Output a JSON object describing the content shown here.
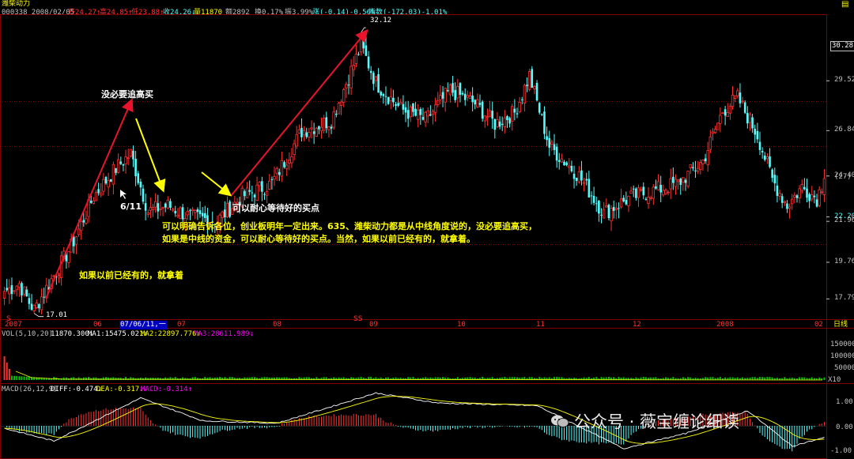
{
  "header": {
    "stock_name": "潍柴动力",
    "line2_code_date": "000338 2008/02/05",
    "open": "开24.27↑",
    "high": "高24.85↑",
    "low": "低23.88↑",
    "close": "收24.26↓",
    "volume": "量11870",
    "amount": "额2892",
    "turnover": "换0.17%",
    "amplitude": "振3.99%",
    "change": "涨(-0.14)-0.56%",
    "index": "指数(-172.03)-1.01%"
  },
  "colors": {
    "up": "#ff3232",
    "down": "#54fcfc",
    "ma1": "#ffffff",
    "ma2": "#ffff00",
    "ma3": "#ff00ff",
    "grid": "#800000",
    "arrow_red": "#e8142d",
    "arrow_yellow": "#ffff00"
  },
  "price_axis": {
    "ticks": [
      "30.28",
      "29.52",
      "26.84",
      "24.40",
      "22.20",
      "21.96",
      "19.76",
      "17.79"
    ],
    "current_badge": "(27)"
  },
  "date_axis": {
    "labels": [
      "2007",
      "06",
      "07/06/11,一",
      "07",
      "08",
      "09",
      "10",
      "11",
      "12",
      "2008",
      "02"
    ],
    "marker_s": "S",
    "marker_ss": "SS",
    "period": "日线"
  },
  "annotations": {
    "high_label": "32.12",
    "low_label": "17.01",
    "no_chase": "没必要追高买",
    "date_611": "6/11",
    "wait_buy": "可以耐心等待好的买点",
    "para1": "可以明确告诉各位，创业板明年一定出来。635、潍柴动力都是从中线角度说的，没必要追高买，",
    "para2": "如果是中线的资金，可以耐心等待好的买点。当然，如果以前已经有的，就拿着。",
    "hold": "如果以前已经有的，就拿着"
  },
  "volume_panel": {
    "title": "VOL(5,10,20)",
    "value": "11870.300↓",
    "ma1": "MA1:15475.021↓",
    "ma2": "MA2:22897.776↓",
    "ma3": "MA3:28611.989↓",
    "ticks": [
      "150000",
      "100000",
      "50000",
      "X10"
    ]
  },
  "macd_panel": {
    "title": "MACD(26,12,9)",
    "diff": "DIFF:-0.474↓",
    "dea": "DEA:-0.317↓",
    "macd": "MACD:-0.314↑",
    "ticks": [
      "1.00",
      "0.00",
      "-1.00"
    ]
  },
  "watermark": "公众号 · 薇宝缠论细读",
  "chart_data": {
    "type": "candlestick",
    "title": "潍柴动力",
    "ylim": [
      16.7,
      33.1
    ],
    "anchors": [
      {
        "i": 0,
        "close": 18.2
      },
      {
        "i": 6,
        "close": 18.6
      },
      {
        "i": 10,
        "close": 17.6
      },
      {
        "i": 12,
        "close": 17.2
      },
      {
        "i": 18,
        "close": 18.6
      },
      {
        "i": 27,
        "close": 20.6
      },
      {
        "i": 36,
        "close": 23.3
      },
      {
        "i": 45,
        "close": 24.8
      },
      {
        "i": 51,
        "close": 25.6
      },
      {
        "i": 58,
        "close": 22.5
      },
      {
        "i": 66,
        "close": 22.8
      },
      {
        "i": 75,
        "close": 22.2
      },
      {
        "i": 86,
        "close": 22.0
      },
      {
        "i": 96,
        "close": 23.3
      },
      {
        "i": 108,
        "close": 24.0
      },
      {
        "i": 120,
        "close": 26.8
      },
      {
        "i": 132,
        "close": 27.4
      },
      {
        "i": 144,
        "close": 31.4
      },
      {
        "i": 150,
        "close": 29.4
      },
      {
        "i": 160,
        "close": 28.0
      },
      {
        "i": 170,
        "close": 27.4
      },
      {
        "i": 180,
        "close": 29.0
      },
      {
        "i": 190,
        "close": 28.3
      },
      {
        "i": 198,
        "close": 27.2
      },
      {
        "i": 206,
        "close": 27.8
      },
      {
        "i": 212,
        "close": 29.8
      },
      {
        "i": 220,
        "close": 26.0
      },
      {
        "i": 232,
        "close": 24.4
      },
      {
        "i": 242,
        "close": 22.4
      },
      {
        "i": 252,
        "close": 23.2
      },
      {
        "i": 262,
        "close": 23.6
      },
      {
        "i": 272,
        "close": 24.0
      },
      {
        "i": 282,
        "close": 25.2
      },
      {
        "i": 290,
        "close": 27.9
      },
      {
        "i": 296,
        "close": 28.6
      },
      {
        "i": 304,
        "close": 26.6
      },
      {
        "i": 310,
        "close": 24.2
      },
      {
        "i": 316,
        "close": 22.8
      },
      {
        "i": 322,
        "close": 23.8
      },
      {
        "i": 328,
        "close": 23.2
      },
      {
        "i": 331,
        "close": 24.26
      }
    ],
    "high": 32.12,
    "low": 17.01,
    "last_close": 24.26,
    "xlabel": "",
    "ylabel": ""
  }
}
